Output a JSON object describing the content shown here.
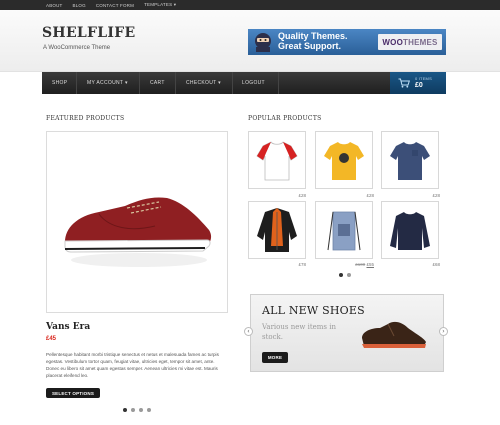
{
  "topbar": {
    "links": [
      "ABOUT",
      "BLOG",
      "CONTACT FORM",
      "TEMPLATES"
    ],
    "templates_caret": "▾"
  },
  "header": {
    "logo": "SHELFLIFE",
    "tagline": "A WooCommerce Theme"
  },
  "banner": {
    "line1": "Quality Themes.",
    "line2": "Great Support.",
    "brand_a": "WOO",
    "brand_b": "THEMES"
  },
  "nav": {
    "items": [
      {
        "label": "SHOP"
      },
      {
        "label": "MY ACCOUNT",
        "caret": "▾"
      },
      {
        "label": "CART"
      },
      {
        "label": "CHECKOUT",
        "caret": "▾"
      },
      {
        "label": "LOGOUT"
      }
    ],
    "cart": {
      "count": "0 ITEMS",
      "total": "£0"
    }
  },
  "featured": {
    "heading": "FEATURED PRODUCTS",
    "title": "Vans Era",
    "price": "£45",
    "description": "Pellentesque habitant morbi tristique senectus et netus et malesuada fames ac turpis egestas. Vestibulum tortor quam, feugiat vitae, ultricies eget, tempor sit amet, ante. Donec eu libero sit amet quam egestas semper. Aenean ultricies mi vitae est. Mauris placerat eleifend leo.",
    "button": "SELECT OPTIONS"
  },
  "popular": {
    "heading": "POPULAR PRODUCTS",
    "items": [
      {
        "price": "£28",
        "icon": "raglan-tshirt-icon"
      },
      {
        "price": "£28",
        "icon": "yellow-tshirt-icon"
      },
      {
        "price": "£28",
        "icon": "blue-tshirt-icon"
      },
      {
        "price": "£78",
        "icon": "parka-jacket-icon"
      },
      {
        "old_price": "£100",
        "price": "£55",
        "icon": "drawstring-bag-icon"
      },
      {
        "price": "£68",
        "icon": "sweater-icon"
      }
    ]
  },
  "promo": {
    "title": "ALL NEW SHOES",
    "subtitle": "Various new items in stock.",
    "button": "MORE",
    "prev": "‹",
    "next": "›"
  },
  "colors": {
    "nav_bg": "#2a2a2a",
    "cart_bg": "#12456f",
    "price_red": "#d9261c",
    "banner_blue": "#2e6aa8"
  },
  "carousel": {
    "featured_pages": 4,
    "featured_active": 1,
    "popular_pages": 2,
    "popular_active": 1
  }
}
